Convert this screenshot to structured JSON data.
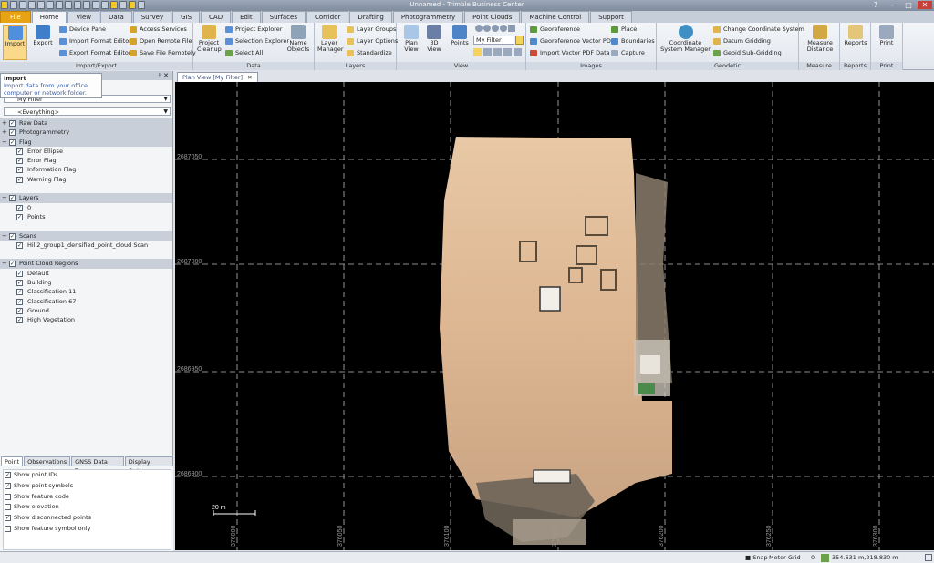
{
  "window": {
    "title": "Unnamed - Trimble Business Center"
  },
  "menu_tabs": [
    "File",
    "Home",
    "View",
    "Data",
    "Survey",
    "GIS",
    "CAD",
    "Edit",
    "Surfaces",
    "Corridor",
    "Drafting",
    "Photogrammetry",
    "Point Clouds",
    "Machine Control",
    "Support"
  ],
  "ribbon": {
    "import_export": {
      "label": "Import/Export",
      "import": "Import",
      "export": "Export",
      "device_pane": "Device Pane",
      "import_format_editor": "Import Format Editor",
      "export_format_editor": "Export Format Editor",
      "access_services": "Access Services",
      "open_remote_file": "Open Remote File",
      "save_file_remotely": "Save File Remotely"
    },
    "data": {
      "label": "Data",
      "project_cleanup": "Project Cleanup",
      "project_explorer": "Project Explorer",
      "selection_explorer": "Selection Explorer",
      "select_all": "Select All",
      "name_objects": "Name Objects"
    },
    "layers": {
      "label": "Layers",
      "layer_manager": "Layer Manager",
      "layer_groups": "Layer Groups",
      "layer_options": "Layer Options",
      "standardize": "Standardize"
    },
    "view": {
      "label": "View",
      "plan_view": "Plan View",
      "view_3d": "3D View",
      "points": "Points",
      "filter": "My Filter"
    },
    "images": {
      "label": "Images",
      "georeference": "Georeference",
      "georeference_vector_pdf": "Georeference Vector PDF",
      "import_vector_pdf_data": "Import Vector PDF Data",
      "place": "Place",
      "boundaries": "Boundaries",
      "capture": "Capture"
    },
    "geodetic": {
      "label": "Geodetic",
      "coordinate_system_manager": "Coordinate System Manager",
      "change_coordinate_system": "Change Coordinate System",
      "datum_gridding": "Datum Gridding",
      "geoid_sub_gridding": "Geoid Sub-Gridding"
    },
    "measure": {
      "label": "Measure",
      "measure_distance": "Measure Distance"
    },
    "reports": {
      "label": "Reports",
      "reports": "Reports"
    },
    "print": {
      "label": "Print",
      "print": "Print"
    }
  },
  "tooltip": {
    "title": "Import",
    "text": "Import data from your office computer or network folder."
  },
  "left_pane": {
    "filter_value": "My Filter",
    "everything_value": "<Everything>",
    "tree": [
      {
        "label": "Raw Data",
        "group": true,
        "checked": true,
        "expand": "+"
      },
      {
        "label": "Photogrammetry",
        "group": true,
        "checked": true,
        "expand": "+"
      },
      {
        "label": "Flag",
        "group": true,
        "checked": true,
        "expand": "−"
      },
      {
        "label": "Error Ellipse",
        "group": false,
        "checked": true
      },
      {
        "label": "Error Flag",
        "group": false,
        "checked": true
      },
      {
        "label": "Information Flag",
        "group": false,
        "checked": true
      },
      {
        "label": "Warning Flag",
        "group": false,
        "checked": true
      },
      {
        "label": "",
        "group": false,
        "spacer": true
      },
      {
        "label": "Layers",
        "group": true,
        "checked": true,
        "expand": "−"
      },
      {
        "label": "0",
        "group": false,
        "checked": true
      },
      {
        "label": "Points",
        "group": false,
        "checked": true
      },
      {
        "label": "",
        "group": false,
        "spacer": true
      },
      {
        "label": "Scans",
        "group": true,
        "checked": true,
        "expand": "−"
      },
      {
        "label": "Hili2_group1_densified_point_cloud Scan",
        "group": false,
        "checked": true
      },
      {
        "label": "",
        "group": false,
        "spacer": true
      },
      {
        "label": "Point Cloud Regions",
        "group": true,
        "checked": true,
        "expand": "−"
      },
      {
        "label": "Default",
        "group": false,
        "checked": true
      },
      {
        "label": "Building",
        "group": false,
        "checked": true
      },
      {
        "label": "Classification 11",
        "group": false,
        "checked": true
      },
      {
        "label": "Classification 67",
        "group": false,
        "checked": true
      },
      {
        "label": "Ground",
        "group": false,
        "checked": true
      },
      {
        "label": "High Vegetation",
        "group": false,
        "checked": true
      }
    ]
  },
  "bottom_pane": {
    "tabs": [
      "Point",
      "Observations",
      "GNSS Data Types",
      "Display Options"
    ],
    "options": [
      {
        "label": "Show point IDs",
        "checked": true
      },
      {
        "label": "Show point symbols",
        "checked": true
      },
      {
        "label": "Show feature code",
        "checked": false
      },
      {
        "label": "Show elevation",
        "checked": false
      },
      {
        "label": "Show disconnected points",
        "checked": true
      },
      {
        "label": "Show feature symbol only",
        "checked": false
      }
    ]
  },
  "view_tab": {
    "label": "Plan View [My Filter]"
  },
  "map": {
    "y_labels": [
      "2687050",
      "2687000",
      "2686950",
      "2686900"
    ],
    "x_labels": [
      "376000",
      "376050",
      "376100",
      "376150",
      "376200",
      "376250",
      "376300"
    ],
    "scale_label": "20 m"
  },
  "status_bar": {
    "snap": "Snap",
    "units": "Meter",
    "grid": "Grid",
    "value": "0",
    "coords": "354.631 m,218.830 m"
  }
}
